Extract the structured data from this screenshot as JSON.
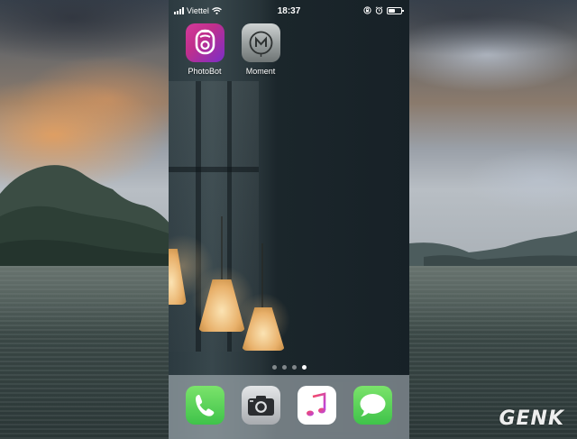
{
  "status_bar": {
    "carrier": "Viettel",
    "time": "18:37",
    "battery_level": 0.55
  },
  "home_apps": [
    {
      "label": "PhotoBot",
      "icon": "photobot-icon"
    },
    {
      "label": "Moment",
      "icon": "moment-icon"
    }
  ],
  "page_indicator": {
    "total_pages": 4,
    "current_page": 4
  },
  "dock": [
    {
      "name": "Phone",
      "icon": "phone-icon"
    },
    {
      "name": "Camera",
      "icon": "camera-icon"
    },
    {
      "name": "Music",
      "icon": "music-icon"
    },
    {
      "name": "Messages",
      "icon": "messages-icon"
    }
  ],
  "watermark": "GENK",
  "colors": {
    "photobot_gradient": [
      "#d43a9a",
      "#7a2ec8"
    ],
    "phone_green": "#4cd35a",
    "music_pink": "#f0467a"
  }
}
